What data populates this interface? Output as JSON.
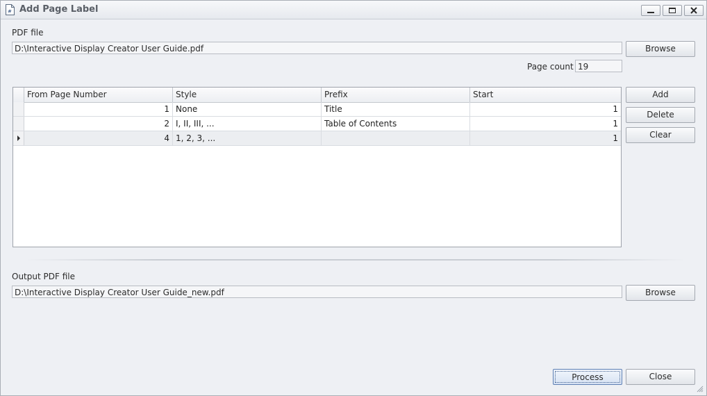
{
  "window": {
    "title": "Add Page Label"
  },
  "pdf_file": {
    "label": "PDF file",
    "value": "D:\\Interactive Display Creator User Guide.pdf",
    "browse_label": "Browse"
  },
  "page_count": {
    "label": "Page count",
    "value": "19"
  },
  "table": {
    "columns": [
      "From Page Number",
      "Style",
      "Prefix",
      "Start"
    ],
    "rows": [
      {
        "from": "1",
        "style": "None",
        "prefix": "Title",
        "start": "1"
      },
      {
        "from": "2",
        "style": "I, II, III, ...",
        "prefix": "Table of Contents",
        "start": "1"
      },
      {
        "from": "4",
        "style": "1, 2, 3, ...",
        "prefix": "",
        "start": "1"
      }
    ]
  },
  "side_buttons": {
    "add": "Add",
    "delete": "Delete",
    "clear": "Clear"
  },
  "output_file": {
    "label": "Output PDF file",
    "value": "D:\\Interactive Display Creator User Guide_new.pdf",
    "browse_label": "Browse"
  },
  "footer": {
    "process": "Process",
    "close": "Close"
  },
  "colors": {
    "window_bg": "#eef0f4",
    "primary_button_border": "#5d7fb3"
  },
  "icons": {
    "title": "document-icon",
    "minimize": "minimize-icon",
    "maximize": "maximize-icon",
    "close": "close-icon"
  }
}
